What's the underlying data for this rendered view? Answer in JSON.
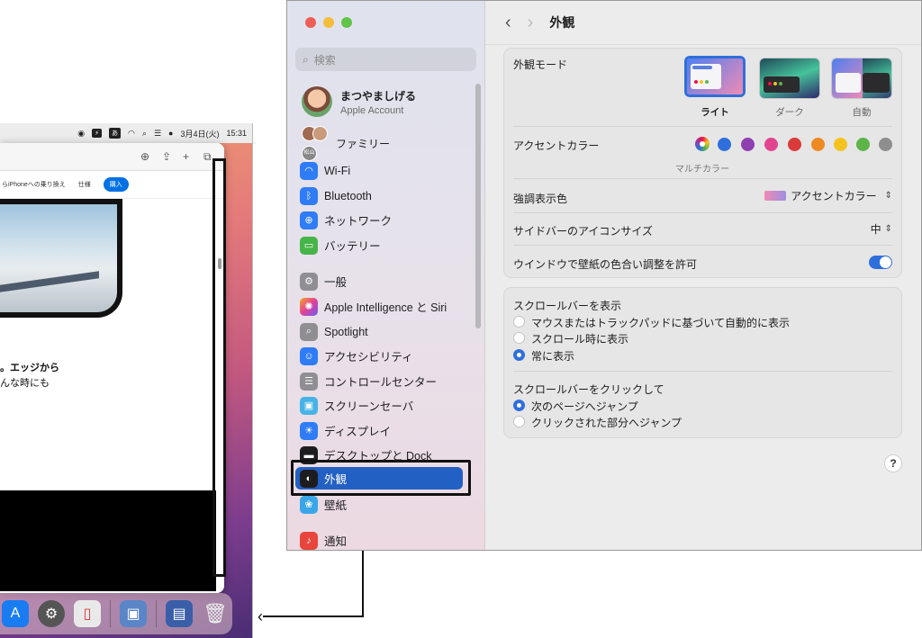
{
  "desktop": {
    "menubar": {
      "date": "3月4日(火)",
      "time": "15:31",
      "ime_badge": "あ"
    },
    "site_nav": {
      "item1": "らiPhoneへの乗り換え",
      "item2": "仕様",
      "buy": "購入"
    },
    "copy_line1": "。エッジから",
    "copy_line2": "んな時にも"
  },
  "settings": {
    "title": "外観",
    "search_placeholder": "検索",
    "account": {
      "name": "まつやましげる",
      "subtitle": "Apple Account"
    },
    "family": {
      "label": "ファミリー",
      "badge": "松山"
    },
    "sidebar": [
      {
        "label": "Wi-Fi",
        "icon": "wifi-icon"
      },
      {
        "label": "Bluetooth",
        "icon": "bluetooth-icon"
      },
      {
        "label": "ネットワーク",
        "icon": "globe-icon"
      },
      {
        "label": "バッテリー",
        "icon": "battery-icon"
      },
      {
        "label": "一般",
        "icon": "gear-icon"
      },
      {
        "label": "Apple Intelligence と Siri",
        "icon": "siri-icon"
      },
      {
        "label": "Spotlight",
        "icon": "magnifier-icon"
      },
      {
        "label": "アクセシビリティ",
        "icon": "accessibility-icon"
      },
      {
        "label": "コントロールセンター",
        "icon": "control-center-icon"
      },
      {
        "label": "スクリーンセーバ",
        "icon": "screensaver-icon"
      },
      {
        "label": "ディスプレイ",
        "icon": "brightness-icon"
      },
      {
        "label": "デスクトップと Dock",
        "icon": "dock-icon"
      },
      {
        "label": "外観",
        "icon": "appearance-icon",
        "selected": true
      },
      {
        "label": "壁紙",
        "icon": "wallpaper-icon"
      },
      {
        "label": "通知",
        "icon": "bell-icon"
      }
    ],
    "appearance": {
      "mode_label": "外観モード",
      "modes": [
        "ライト",
        "ダーク",
        "自動"
      ],
      "selected_mode": "ライト",
      "accent_label": "アクセントカラー",
      "accent_selected_label": "マルチカラー",
      "accent_colors": [
        "#2f6fdb",
        "#8e3fb0",
        "#e2458f",
        "#d93a3a",
        "#ee8a22",
        "#f4c320",
        "#5bb548",
        "#8e8e8e"
      ],
      "highlight_label": "強調表示色",
      "highlight_value": "アクセントカラー",
      "sidebar_icon_label": "サイドバーのアイコンサイズ",
      "sidebar_icon_value": "中",
      "tint_label": "ウインドウで壁紙の色合い調整を許可",
      "tint_on": true
    },
    "scrollbars": {
      "show_label": "スクロールバーを表示",
      "show_options": [
        "マウスまたはトラックパッドに基づいて自動的に表示",
        "スクロール時に表示",
        "常に表示"
      ],
      "show_selected": 2,
      "click_label": "スクロールバーをクリックして",
      "click_options": [
        "次のページへジャンプ",
        "クリックされた部分へジャンプ"
      ],
      "click_selected": 0
    },
    "help": "?"
  }
}
